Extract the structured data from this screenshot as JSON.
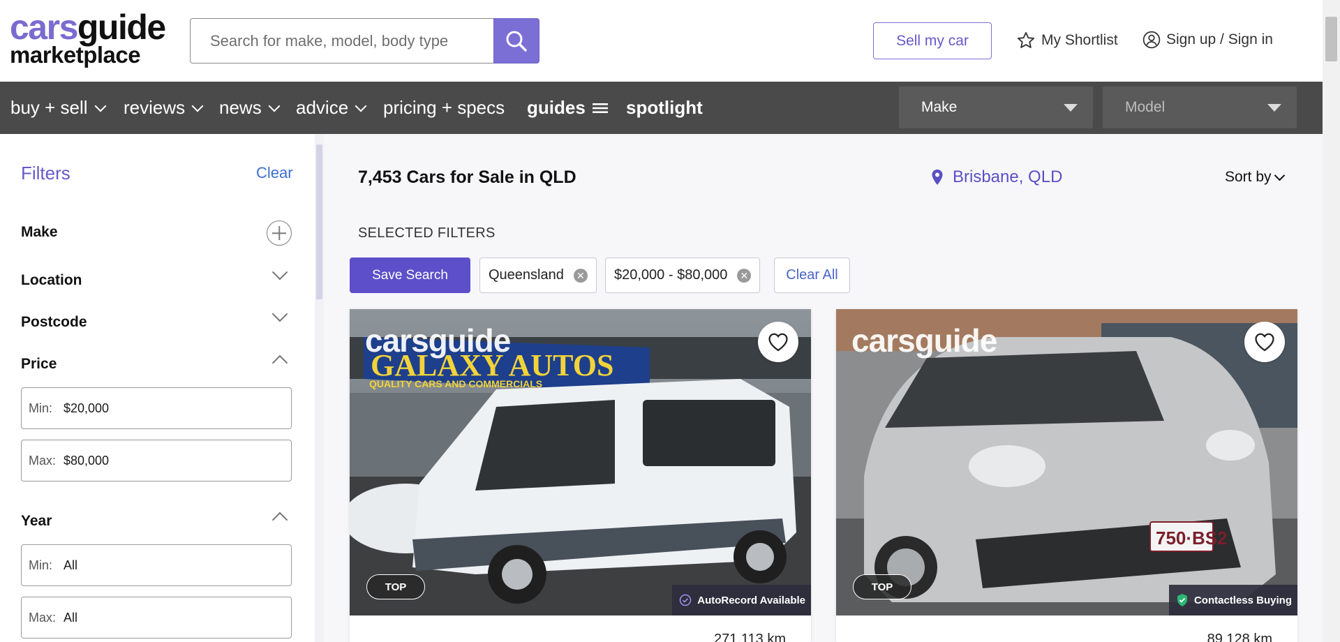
{
  "header": {
    "logo_line1_a": "cars",
    "logo_line1_b": "guide",
    "logo_line2": "marketplace",
    "search_placeholder": "Search for make, model, body type",
    "sell_label": "Sell my car",
    "shortlist_label": "My Shortlist",
    "signin_label": "Sign up / Sign in"
  },
  "nav": {
    "items": [
      {
        "label": "buy + sell"
      },
      {
        "label": "reviews"
      },
      {
        "label": "news"
      },
      {
        "label": "advice"
      },
      {
        "label": "pricing + specs"
      },
      {
        "label": "guides"
      },
      {
        "label": "spotlight"
      }
    ],
    "make_select": "Make",
    "model_select": "Model"
  },
  "filters": {
    "title": "Filters",
    "clear": "Clear",
    "make": "Make",
    "location": "Location",
    "postcode": "Postcode",
    "price": "Price",
    "price_min_label": "Min:",
    "price_min": "$20,000",
    "price_max_label": "Max:",
    "price_max": "$80,000",
    "year": "Year",
    "year_min_label": "Min:",
    "year_min": "All",
    "year_max_label": "Max:",
    "year_max": "All"
  },
  "results": {
    "title": "7,453 Cars for Sale in QLD",
    "location": "Brisbane, QLD",
    "sort": "Sort by",
    "selected_filters": "SELECTED FILTERS",
    "save_search": "Save Search",
    "chips": [
      "Queensland",
      "$20,000 - $80,000"
    ],
    "clear_all": "Clear All"
  },
  "cards": [
    {
      "watermark": "carsguide",
      "badge": "TOP",
      "feature": "AutoRecord Available",
      "km": "271,113 km",
      "sign_text": "GALAXY AUTOS",
      "sign_sub": "QUALITY CARS AND COMMERCIALS"
    },
    {
      "watermark": "carsguide",
      "badge": "TOP",
      "feature": "Contactless Buying",
      "km": "89,128 km",
      "plate": "750·BS2"
    }
  ],
  "colors": {
    "brand_purple": "#6759c9",
    "nav_bg": "#4a4a4a",
    "link_blue": "#3d6fd1"
  }
}
